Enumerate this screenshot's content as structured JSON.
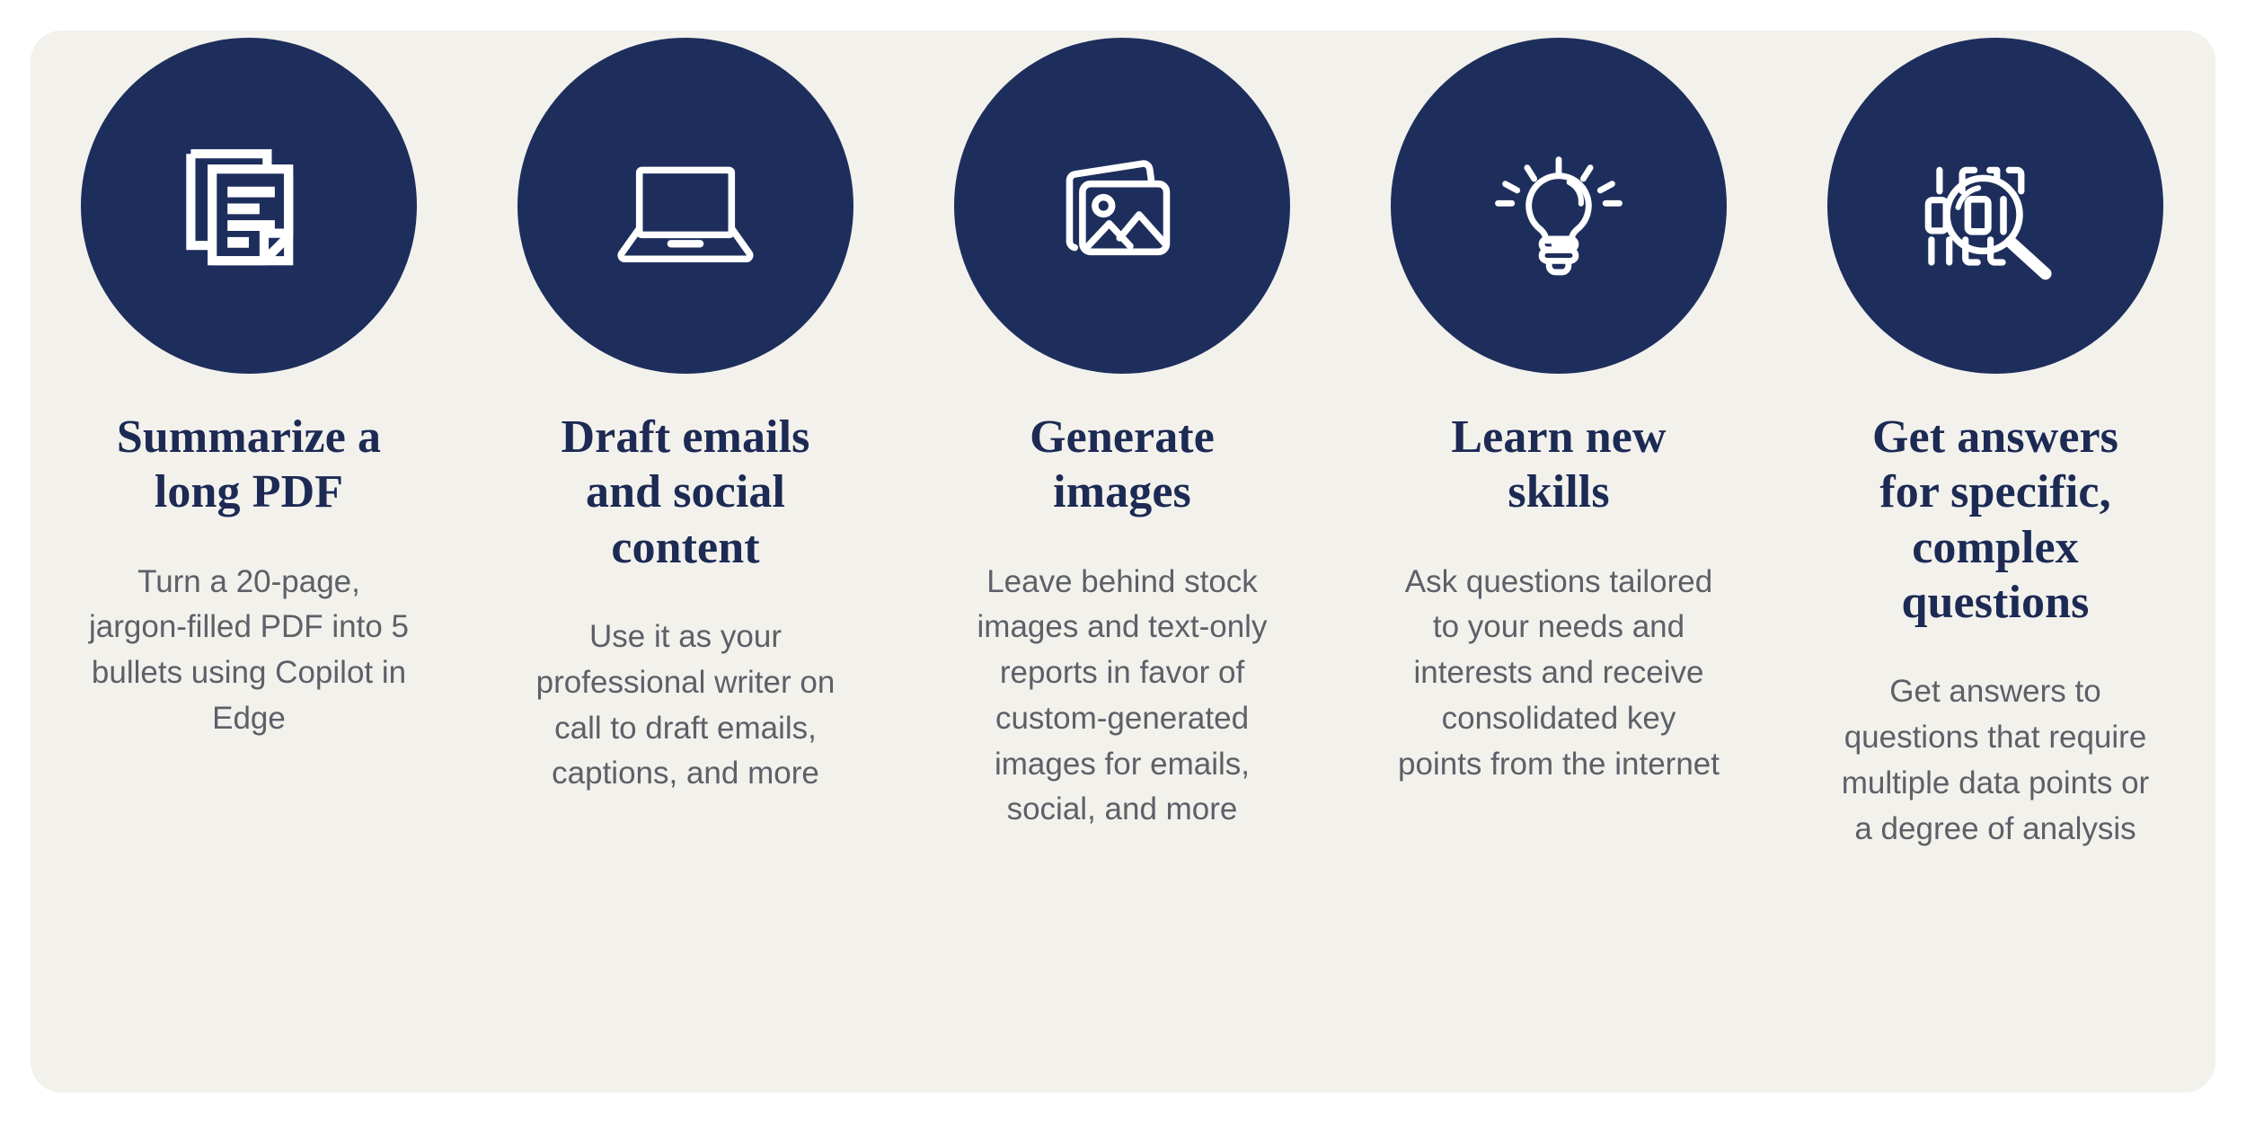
{
  "theme": {
    "page_background": "#ffffff",
    "card_background": "#f2f1ec",
    "circle_color": "#1e2e5c",
    "icon_color": "#ffffff",
    "title_color": "#1c2a54",
    "description_color": "#5c6067"
  },
  "cards": [
    {
      "icon": "documents-icon",
      "title": "Summarize a long PDF",
      "description": "Turn a 20-page, jargon-filled PDF into 5 bullets using Copilot in Edge"
    },
    {
      "icon": "laptop-icon",
      "title": "Draft emails and social content",
      "description": "Use it as your professional writer on call to draft emails, captions, and more"
    },
    {
      "icon": "photos-icon",
      "title": "Generate images",
      "description": "Leave behind stock images and text-only reports in favor of custom-generated images for emails, social, and more"
    },
    {
      "icon": "lightbulb-icon",
      "title": "Learn new skills",
      "description": "Ask questions tailored to your needs and interests and receive consolidated key points from the internet"
    },
    {
      "icon": "binary-search-icon",
      "title": "Get answers for specific, complex questions",
      "description": "Get answers to questions that require multiple data points or a degree of analysis"
    }
  ]
}
